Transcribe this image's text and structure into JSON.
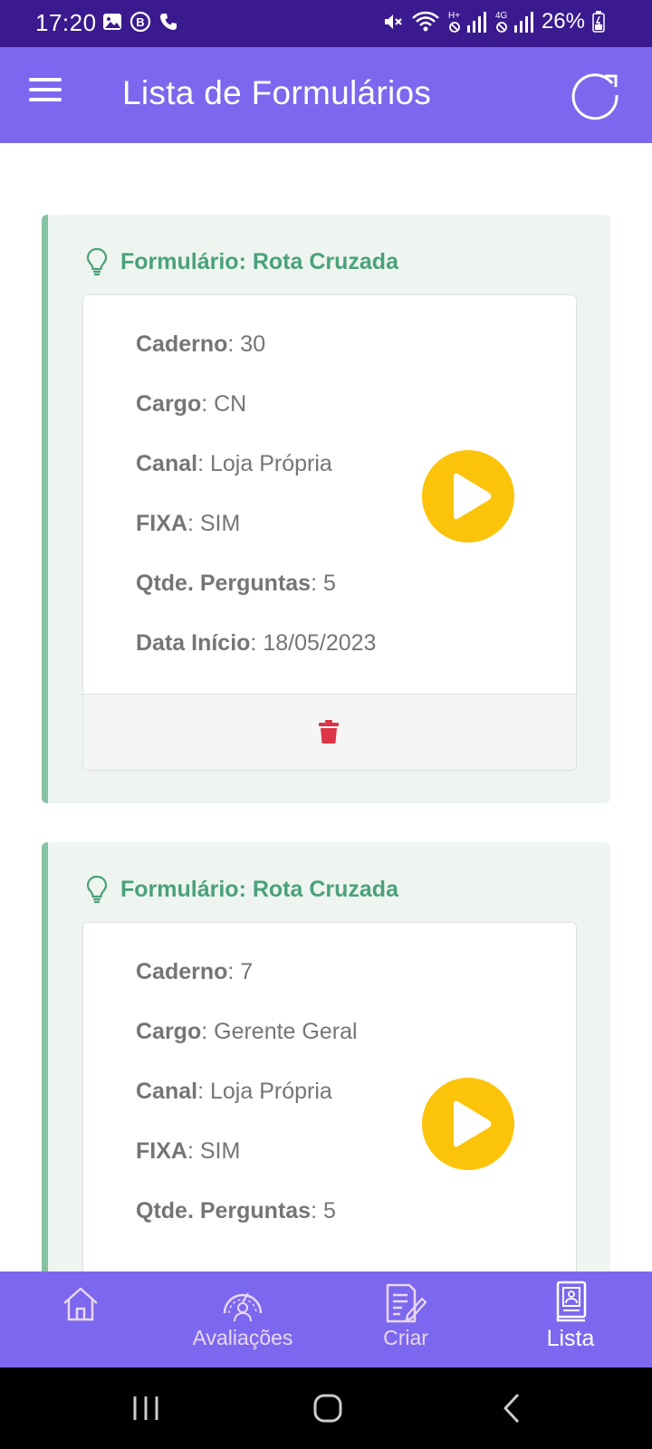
{
  "status_bar": {
    "time": "17:20",
    "battery": "26%",
    "network_labels": [
      "H+",
      "4G"
    ]
  },
  "app_bar": {
    "title": "Lista de Formulários"
  },
  "cards": [
    {
      "title": "Formulário: Rota Cruzada",
      "fields": [
        {
          "label": "Caderno",
          "value": ": 30"
        },
        {
          "label": "Cargo",
          "value": ": CN"
        },
        {
          "label": "Canal",
          "value": ": Loja Própria"
        },
        {
          "label": "FIXA",
          "value": ": SIM"
        },
        {
          "label": "Qtde. Perguntas",
          "value": ": 5"
        },
        {
          "label": "Data Início",
          "value": ": 18/05/2023"
        }
      ]
    },
    {
      "title": "Formulário: Rota Cruzada",
      "fields": [
        {
          "label": "Caderno",
          "value": ": 7"
        },
        {
          "label": "Cargo",
          "value": ": Gerente Geral"
        },
        {
          "label": "Canal",
          "value": ": Loja Própria"
        },
        {
          "label": "FIXA",
          "value": ": SIM"
        },
        {
          "label": "Qtde. Perguntas",
          "value": ": 5"
        }
      ]
    }
  ],
  "bottom_nav": {
    "items": [
      {
        "label": "",
        "icon": "home-icon"
      },
      {
        "label": "Avaliações",
        "icon": "gauge-icon"
      },
      {
        "label": "Criar",
        "icon": "edit-document-icon"
      },
      {
        "label": "Lista",
        "icon": "list-book-icon",
        "active": true
      }
    ]
  },
  "colors": {
    "status_bar": "#3b1a8f",
    "app_bar": "#7b68ee",
    "card_title": "#4aa17a",
    "card_border": "#86c2a3",
    "card_bg": "#eef5f1",
    "play_button": "#fcc30b",
    "trash": "#dc3545"
  }
}
